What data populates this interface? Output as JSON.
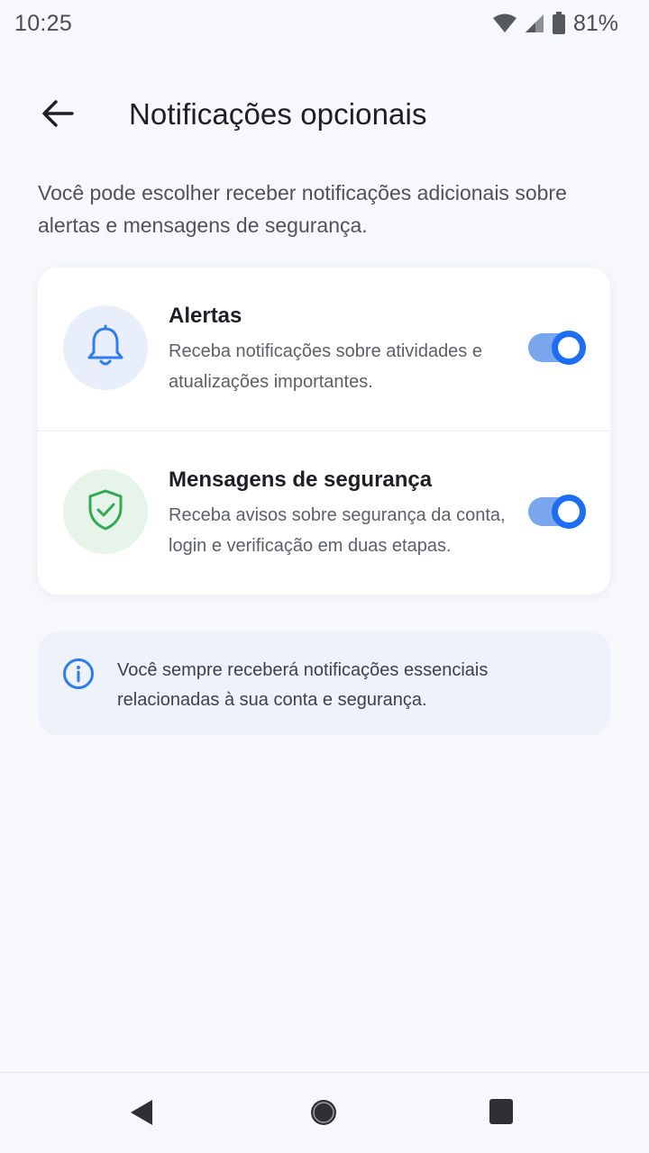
{
  "status_bar": {
    "time": "10:25",
    "battery": "81%",
    "icons": [
      "wifi-icon",
      "cell-signal-icon",
      "battery-icon"
    ]
  },
  "header": {
    "title": "Notificações opcionais",
    "back_icon": "arrow-left-icon"
  },
  "description": "Você pode escolher receber notificações adicionais sobre alertas e mensagens de segurança.",
  "settings": [
    {
      "title": "Alertas",
      "description": "Receba notificações sobre atividades e atualizações importantes.",
      "icon": "bell-icon",
      "enabled": true
    },
    {
      "title": "Mensagens de segurança",
      "description": "Receba avisos sobre segurança da conta, login e verificação em duas etapas.",
      "icon": "shield-check-icon",
      "enabled": true
    }
  ],
  "info": {
    "icon": "info-icon",
    "text": "Você sempre receberá notificações essenciais relacionadas à sua conta e segurança."
  },
  "nav_bar": {
    "buttons": [
      "back-triangle-icon",
      "home-circle-icon",
      "recents-square-icon"
    ]
  },
  "colors": {
    "accent": "#1d6ef0",
    "toggle_track": "#7aa6ee",
    "bell_bg": "#e8effb",
    "shield_bg": "#e6f4e9",
    "shield_stroke": "#34a853",
    "info_bg": "#edf2fb"
  }
}
